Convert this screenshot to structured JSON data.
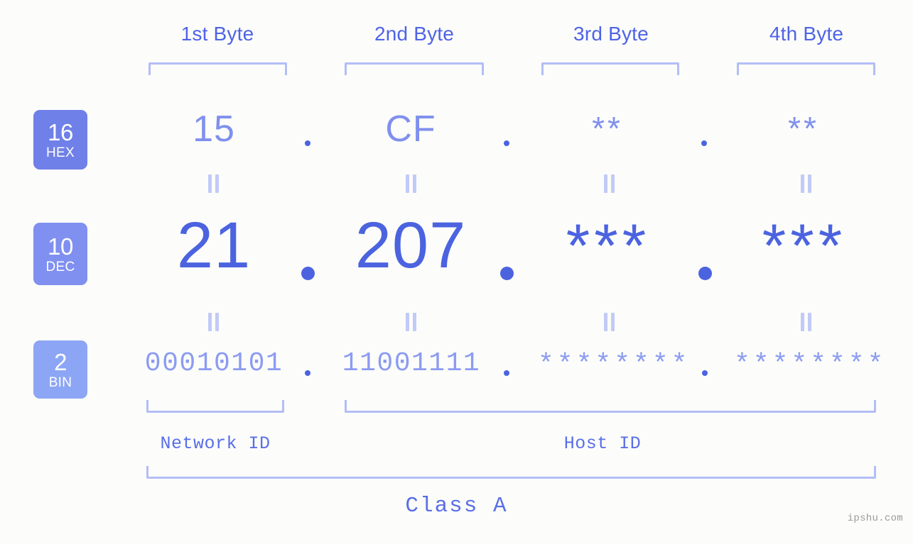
{
  "meta": {
    "watermark": "ipshu.com",
    "background_color": "#fcfdfa",
    "accent_strong": "#4c63e0",
    "accent_light": "#8090ee",
    "bracket_color": "#b3bdf7"
  },
  "byte_headers": [
    {
      "label": "1st Byte"
    },
    {
      "label": "2nd Byte"
    },
    {
      "label": "3rd Byte"
    },
    {
      "label": "4th Byte"
    }
  ],
  "rows": [
    {
      "badge_number": "16",
      "badge_name": "HEX",
      "badge_color": "#6f80e8",
      "values": [
        "15",
        "CF",
        "**",
        "**"
      ]
    },
    {
      "badge_number": "10",
      "badge_name": "DEC",
      "badge_color": "#8090f0",
      "values": [
        "21",
        "207",
        "***",
        "***"
      ]
    },
    {
      "badge_number": "2",
      "badge_name": "BIN",
      "badge_color": "#8ca5f5",
      "values": [
        "00010101",
        "11001111",
        "********",
        "********"
      ]
    }
  ],
  "separators": {
    "dot": ".",
    "equals": "="
  },
  "sections": [
    {
      "label": "Network ID"
    },
    {
      "label": "Host ID"
    }
  ],
  "class": {
    "label": "Class A"
  }
}
